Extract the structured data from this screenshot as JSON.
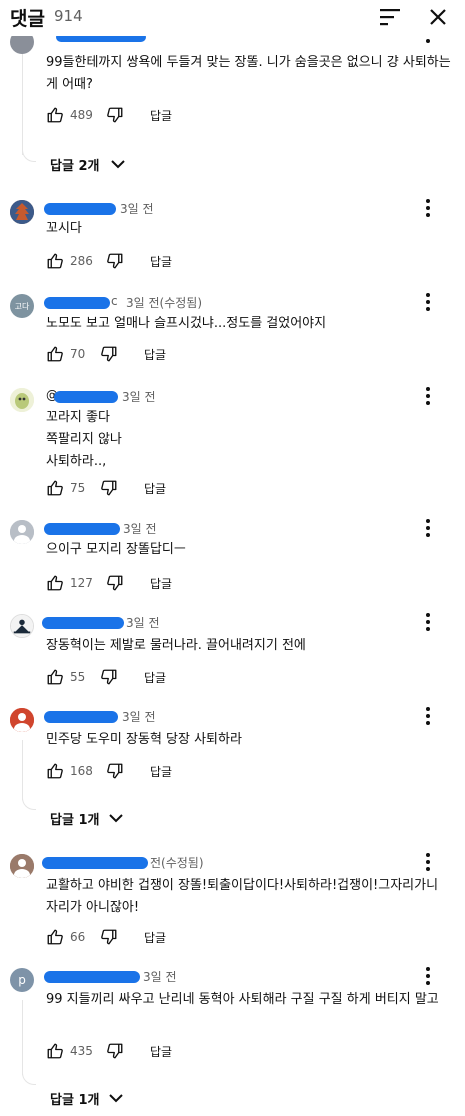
{
  "header": {
    "title": "댓글",
    "count": "914"
  },
  "comments": [
    {
      "handle": "@",
      "time": "",
      "text": "99들한테까지 쌍욕에 두들겨 맞는 장똘. 니가 숨을곳은 없으니 걍 사퇴하는게 어때?",
      "likes": "489",
      "reply_label": "답글",
      "replies_label": "답글 2개"
    },
    {
      "handle": "@",
      "time": "3일 전",
      "text": "꼬시다",
      "likes": "286",
      "reply_label": "답글"
    },
    {
      "handle": "@",
      "avatar_text": "고다",
      "time": "3일 전(수정됨)",
      "handle_suffix": "c",
      "text": "노모도 보고 얼매나 슬프시겄냐...정도를 걸었어야지",
      "likes": "70",
      "reply_label": "답글"
    },
    {
      "handle": "@",
      "time": "3일 전",
      "text": "꼬라지  좋다\n쪽팔리지  않나\n사퇴하라..,",
      "likes": "75",
      "reply_label": "답글"
    },
    {
      "handle": "@",
      "time": "3일 전",
      "text": "으이구 모지리 장똘답디ㅡ",
      "likes": "127",
      "reply_label": "답글"
    },
    {
      "handle": "@",
      "time": "3일 전",
      "text": "장동혁이는 제발로 물러나라. 끌어내려지기 전에",
      "likes": "55",
      "reply_label": "답글"
    },
    {
      "handle": "@",
      "time": "3일 전",
      "text": "민주당 도우미 장동혁 당장 사퇴하라",
      "likes": "168",
      "reply_label": "답글",
      "replies_label": "답글 1개"
    },
    {
      "handle": "@",
      "time": "전(수정됨)",
      "text": "교활하고 야비한 겁쟁이 장똘!퇴출이답이다!사퇴하라!겁쟁이!그자리가니 자리가 아니잖아!",
      "likes": "66",
      "reply_label": "답글"
    },
    {
      "handle": "@",
      "avatar_text": "p",
      "time": "3일 전",
      "text": "99 지들끼리 싸우고 난리네 동혁아 사퇴해라 구질 구질 하게 버티지 말고",
      "likes": "435",
      "reply_label": "답글",
      "replies_label": "답글 1개"
    }
  ],
  "colors": {
    "redaction": "#1a73e8",
    "text": "#0f0f0f",
    "secondary": "#606060"
  },
  "icons": [
    "sort-icon",
    "close-icon",
    "more-vert-icon",
    "thumb-up-icon",
    "thumb-down-icon",
    "chevron-down-icon"
  ]
}
